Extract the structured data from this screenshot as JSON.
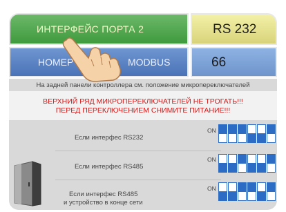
{
  "interface": {
    "label": "ИНТЕРФЕЙС ПОРТА 2",
    "value": "RS 232"
  },
  "modbus": {
    "label_left": "НОМЕР",
    "label_right": "MODBUS",
    "value": "66"
  },
  "hint": "На задней панели контроллера см. положение микропереключателей",
  "warning": {
    "line1": "ВЕРХНИЙ РЯД МИКРОПЕРЕКЛЮЧАТЕЛЕЙ НЕ ТРОГАТЬ!!!",
    "line2": "ПЕРЕД ПЕРЕКЛЮЧЕНИЕМ СНИМИТЕ ПИТАНИЕ!!!"
  },
  "options": [
    {
      "label": "Если интерфес RS232",
      "on": "ON"
    },
    {
      "label": "Если интерфес RS485",
      "on": "ON"
    },
    {
      "label1": "Если интерфес RS485",
      "label2": "и устройство в конце сети",
      "on": "ON"
    }
  ],
  "dip_rows": [
    {
      "top": [
        0,
        0,
        0,
        1,
        1,
        0
      ],
      "bottom": [
        1,
        1,
        1,
        0,
        0,
        1
      ]
    },
    {
      "top": [
        1,
        1,
        0,
        1,
        1,
        0
      ],
      "bottom": [
        0,
        0,
        1,
        0,
        0,
        1
      ]
    },
    {
      "top": [
        1,
        1,
        0,
        0,
        1,
        0
      ],
      "bottom": [
        0,
        0,
        1,
        1,
        0,
        1
      ]
    }
  ],
  "colors": {
    "green": "#3f9a3d",
    "yellow": "#d8d37a",
    "blue": "#4a73b8",
    "dip": "#2c6cc5",
    "warning": "#d81818"
  },
  "icons": [
    "pointing-hand-icon",
    "cabinet-door-icon"
  ]
}
